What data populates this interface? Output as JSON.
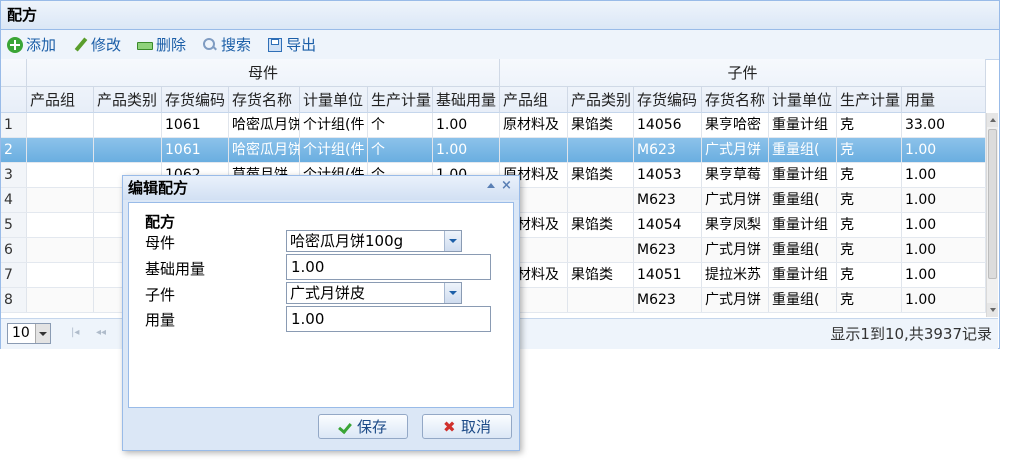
{
  "panel": {
    "title": "配方"
  },
  "toolbar": {
    "add": "添加",
    "edit": "修改",
    "delete": "删除",
    "search": "搜索",
    "export": "导出"
  },
  "grid": {
    "groups": {
      "parent": "母件",
      "child": "子件"
    },
    "columns": [
      "产品组",
      "产品类别",
      "存货编码",
      "存货名称",
      "计量单位",
      "生产计量",
      "基础用量",
      "产品组",
      "产品类别",
      "存货编码",
      "存货名称",
      "计量单位",
      "生产计量",
      "用量"
    ],
    "rows": [
      [
        "1",
        "",
        "",
        "1061",
        "哈密瓜月饼",
        "个计组(件",
        "个",
        "1.00",
        "原材料及",
        "果馅类",
        "14056",
        "果亨哈密",
        "重量计组",
        "克",
        "33.00"
      ],
      [
        "2",
        "",
        "",
        "1061",
        "哈密瓜月饼",
        "个计组(件",
        "个",
        "1.00",
        "",
        "",
        "M623",
        "广式月饼",
        "重量组(",
        "克",
        "1.00"
      ],
      [
        "3",
        "",
        "",
        "1062",
        "草莓月饼",
        "个计组(件",
        "个",
        "1.00",
        "原材料及",
        "果馅类",
        "14053",
        "果亨草莓",
        "重量计组",
        "克",
        "1.00"
      ],
      [
        "4",
        "",
        "",
        "",
        "",
        "",
        "",
        "",
        "",
        "",
        "M623",
        "广式月饼",
        "重量组(",
        "克",
        "1.00"
      ],
      [
        "5",
        "",
        "",
        "",
        "",
        "",
        "",
        "",
        "原材料及",
        "果馅类",
        "14054",
        "果亨凤梨",
        "重量计组",
        "克",
        "1.00"
      ],
      [
        "6",
        "",
        "",
        "",
        "",
        "",
        "",
        "",
        "",
        "",
        "M623",
        "广式月饼",
        "重量组(",
        "克",
        "1.00"
      ],
      [
        "7",
        "",
        "",
        "",
        "",
        "",
        "",
        "",
        "原材料及",
        "果馅类",
        "14051",
        "提拉米苏",
        "重量计组",
        "克",
        "1.00"
      ],
      [
        "8",
        "",
        "",
        "",
        "",
        "",
        "",
        "",
        "",
        "",
        "M623",
        "广式月饼",
        "重量组(",
        "克",
        "1.00"
      ]
    ],
    "selected_row": 2
  },
  "pager": {
    "page_size": "10",
    "info": "显示1到10,共3937记录",
    "first": "|◂",
    "prev": "◂◂"
  },
  "dialog": {
    "title": "编辑配方",
    "fieldset": "配方",
    "labels": {
      "parent": "母件",
      "base_qty": "基础用量",
      "child": "子件",
      "qty": "用量"
    },
    "values": {
      "parent": "哈密瓜月饼100g",
      "base_qty": "1.00",
      "child": "广式月饼皮",
      "qty": "1.00"
    },
    "buttons": {
      "save": "保存",
      "cancel": "取消"
    },
    "close": "×"
  }
}
